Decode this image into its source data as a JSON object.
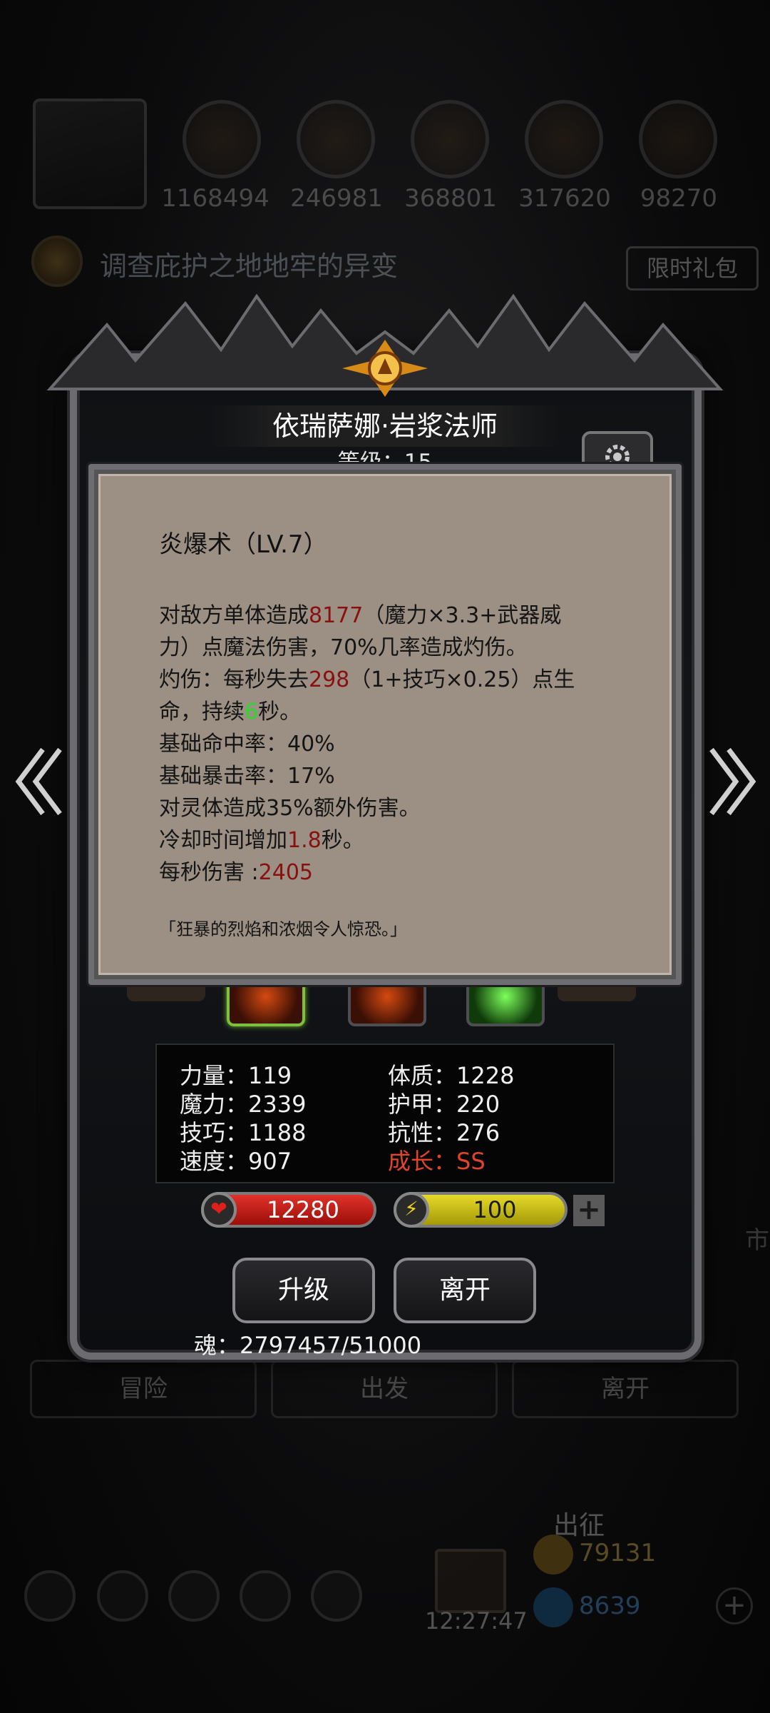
{
  "background": {
    "resources": [
      "1168494",
      "246981",
      "368801",
      "317620",
      "98270"
    ],
    "quest_text": "调查庇护之地地牢的异变",
    "gift_label": "限时礼包",
    "bottom_buttons": [
      "冒险",
      "出发",
      "离开"
    ],
    "march_label": "出征",
    "coins": "79131",
    "gems": "8639",
    "clock": "12:27:47",
    "side_char": "市"
  },
  "hero": {
    "name": "依瑞萨娜·岩浆法师",
    "level_text": "等级：15"
  },
  "skill_popup": {
    "title": "炎爆术（LV.7）",
    "line1": {
      "a": "对敌方单体造成",
      "damage": "8177",
      "b": "（魔力×3.3+武器威"
    },
    "line2": "力）点魔法伤害，70%几率造成灼伤。",
    "line3": {
      "a": "灼伤：每秒失去",
      "burn": "298",
      "b": "（1+技巧×0.25）点生"
    },
    "line4": {
      "a": "命，持续",
      "duration": "6",
      "b": "秒。"
    },
    "line5": "基础命中率：40%",
    "line6": "基础暴击率：17%",
    "line7": "对灵体造成35%额外伤害。",
    "line8": {
      "a": "冷却时间增加",
      "cooldown": "1.8",
      "b": "秒。"
    },
    "line9": {
      "a": "每秒伤害 :",
      "dps": "2405"
    },
    "flavor": "「狂暴的烈焰和浓烟令人惊恐。」"
  },
  "stats": {
    "strength": {
      "label": "力量：",
      "value": "119"
    },
    "magic": {
      "label": "魔力：",
      "value": "2339"
    },
    "skill": {
      "label": "技巧：",
      "value": "1188"
    },
    "speed": {
      "label": "速度：",
      "value": "907"
    },
    "constitution": {
      "label": "体质：",
      "value": "1228"
    },
    "armor": {
      "label": "护甲：",
      "value": "220"
    },
    "resistance": {
      "label": "抗性：",
      "value": "276"
    },
    "growth": {
      "label": "成长：",
      "value": "SS"
    }
  },
  "bars": {
    "hp": "12280",
    "energy": "100"
  },
  "actions": {
    "upgrade": "升级",
    "leave": "离开"
  },
  "soul_text": "魂：2797457/51000",
  "colors": {
    "damage_red": "#8a1010",
    "duration_green": "#2bd82b",
    "growth_red": "#e0442a",
    "hp_red": "#e0322a",
    "energy_yellow": "#e6d92a"
  },
  "icons": [
    "gear-icon",
    "heart-icon",
    "lightning-icon",
    "plus-icon",
    "chevron-left-icon",
    "chevron-right-icon",
    "emblem-icon"
  ]
}
